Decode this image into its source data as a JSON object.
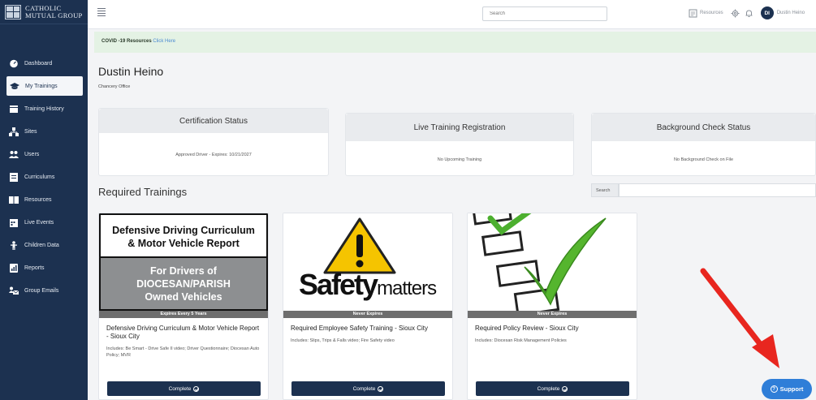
{
  "brand": {
    "line1": "CATHOLIC",
    "line2": "MUTUAL GROUP"
  },
  "sidebar": {
    "items": [
      {
        "label": "Dashboard",
        "icon": "dashboard-icon"
      },
      {
        "label": "My Trainings",
        "icon": "graduation-cap-icon",
        "active": true
      },
      {
        "label": "Training History",
        "icon": "folder-icon"
      },
      {
        "label": "Sites",
        "icon": "sitemap-icon"
      },
      {
        "label": "Users",
        "icon": "users-icon"
      },
      {
        "label": "Curriculums",
        "icon": "document-icon"
      },
      {
        "label": "Resources",
        "icon": "book-icon"
      },
      {
        "label": "Live Events",
        "icon": "calendar-icon"
      },
      {
        "label": "Children Data",
        "icon": "child-icon"
      },
      {
        "label": "Reports",
        "icon": "report-icon"
      },
      {
        "label": "Group Emails",
        "icon": "group-email-icon"
      }
    ]
  },
  "topbar": {
    "search_placeholder": "Search",
    "resources_label": "Resources",
    "avatar_initials": "DI",
    "user_label": "Dustin Heino"
  },
  "banner": {
    "bold": "COVID -19 Resources",
    "link": "Click Here"
  },
  "user": {
    "name": "Dustin Heino",
    "office": "Chancery Office"
  },
  "status_cards": {
    "certification": {
      "title": "Certification Status",
      "body": "Approved Driver - Expires: 10/21/2027"
    },
    "live": {
      "title": "Live Training Registration",
      "body": "No Upcoming Training"
    },
    "background": {
      "title": "Background Check Status",
      "body": "No Background Check on File"
    }
  },
  "required": {
    "title": "Required Trainings",
    "search_label": "Search"
  },
  "trainings": [
    {
      "image_top": [
        "Defensive Driving Curriculum",
        "& Motor Vehicle Report"
      ],
      "image_bottom": [
        "For Drivers of",
        "DIOCESAN/PARISH",
        "Owned Vehicles"
      ],
      "expiry": "Expires Every 5 Years",
      "title": "Defensive Driving Curriculum & Motor Vehicle Report - Sioux City",
      "desc": "Includes: Be Smart - Drive Safe II video; Driver Questionnaire; Diocesan Auto Policy; MVR",
      "button": "Complete"
    },
    {
      "image_word1": "Safety",
      "image_word2": "matters",
      "expiry": "Never Expires",
      "title": "Required Employee Safety Training - Sioux City",
      "desc": "Includes: Slips, Trips & Falls video; Fire Safety video",
      "button": "Complete"
    },
    {
      "expiry": "Never Expires",
      "title": "Required Policy Review - Sioux City",
      "desc": "Includes: Diocesan Risk Management Policies",
      "button": "Complete"
    }
  ],
  "support": {
    "label": "Support"
  },
  "colors": {
    "sidebar": "#1c3150",
    "button": "#1c3150",
    "support": "#2f7ed8",
    "banner": "#e4f2e4",
    "arrow": "#e8261f"
  }
}
